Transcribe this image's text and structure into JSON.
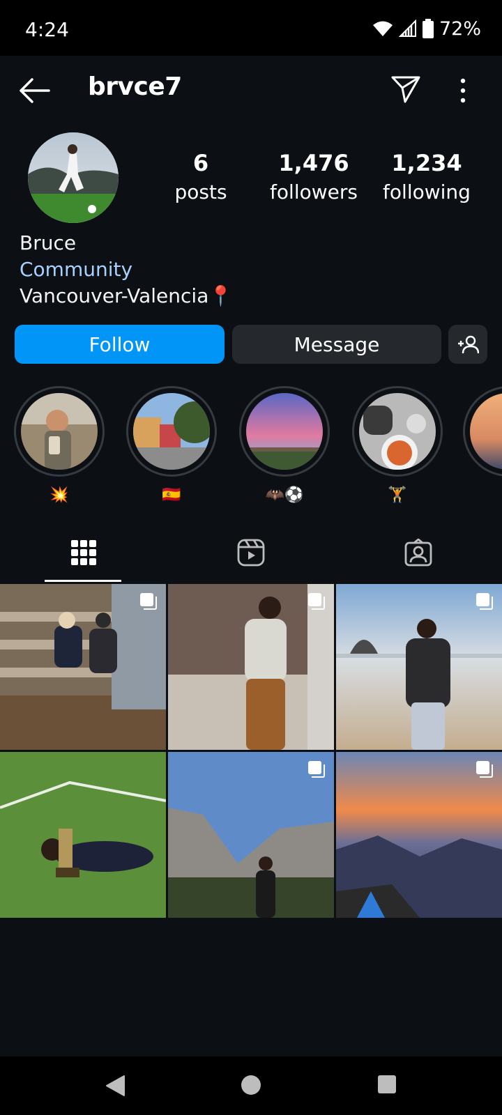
{
  "status_bar": {
    "time": "4:24",
    "battery": "72%"
  },
  "header": {
    "username": "brvce7"
  },
  "profile": {
    "stats": [
      {
        "value": "6",
        "label": "posts"
      },
      {
        "value": "1,476",
        "label": "followers"
      },
      {
        "value": "1,234",
        "label": "following"
      }
    ],
    "name": "Bruce",
    "category": "Community",
    "location": "Vancouver-Valencia📍"
  },
  "actions": {
    "follow": "Follow",
    "message": "Message"
  },
  "highlights": [
    {
      "caption": "💥"
    },
    {
      "caption": "🇪🇸"
    },
    {
      "caption": "🦇⚽"
    },
    {
      "caption": "🏋"
    },
    {
      "caption": ""
    }
  ],
  "tabs": [
    "grid-icon",
    "reels-icon",
    "tagged-icon"
  ],
  "colors": {
    "accent": "#0095f6",
    "category_link": "#a8d1ff",
    "background": "#0c1014"
  }
}
